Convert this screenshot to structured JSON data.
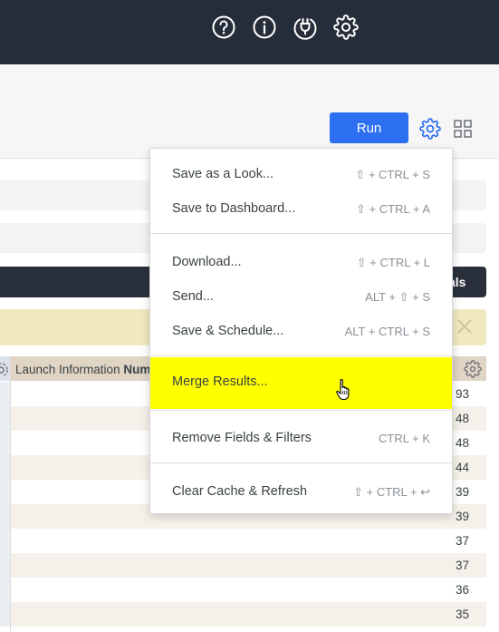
{
  "topbar": {
    "icons": [
      "help-icon",
      "info-icon",
      "plug-icon",
      "gear-icon"
    ]
  },
  "toolbar": {
    "run_label": "Run",
    "gear_icon": "gear-icon",
    "layout_icon": "grid-icon"
  },
  "background": {
    "dark_bar_text": "als",
    "warn_close_icon": "close-icon"
  },
  "table": {
    "column_header_prefix": "Launch Information ",
    "column_header_bold": "Num",
    "values": [
      "93",
      "48",
      "48",
      "44",
      "39",
      "39",
      "37",
      "37",
      "36",
      "35"
    ]
  },
  "menu": {
    "items": [
      {
        "label": "Save as a Look...",
        "shortcut": "⇧ + CTRL + S"
      },
      {
        "label": "Save to Dashboard...",
        "shortcut": "⇧ + CTRL + A"
      },
      {
        "label": "Download...",
        "shortcut": "⇧ + CTRL + L"
      },
      {
        "label": "Send...",
        "shortcut": "ALT + ⇧ + S"
      },
      {
        "label": "Save & Schedule...",
        "shortcut": "ALT + CTRL + S"
      },
      {
        "label": "Merge Results...",
        "shortcut": ""
      },
      {
        "label": "Remove Fields & Filters",
        "shortcut": "CTRL + K"
      },
      {
        "label": "Clear Cache & Refresh",
        "shortcut": "⇧ + CTRL + ↩"
      }
    ]
  },
  "colors": {
    "topbar": "#262d3a",
    "run_button": "#2d6ff1",
    "highlight": "#ffff00",
    "warning": "#f1e9be",
    "column_header": "#e0d4c4"
  }
}
